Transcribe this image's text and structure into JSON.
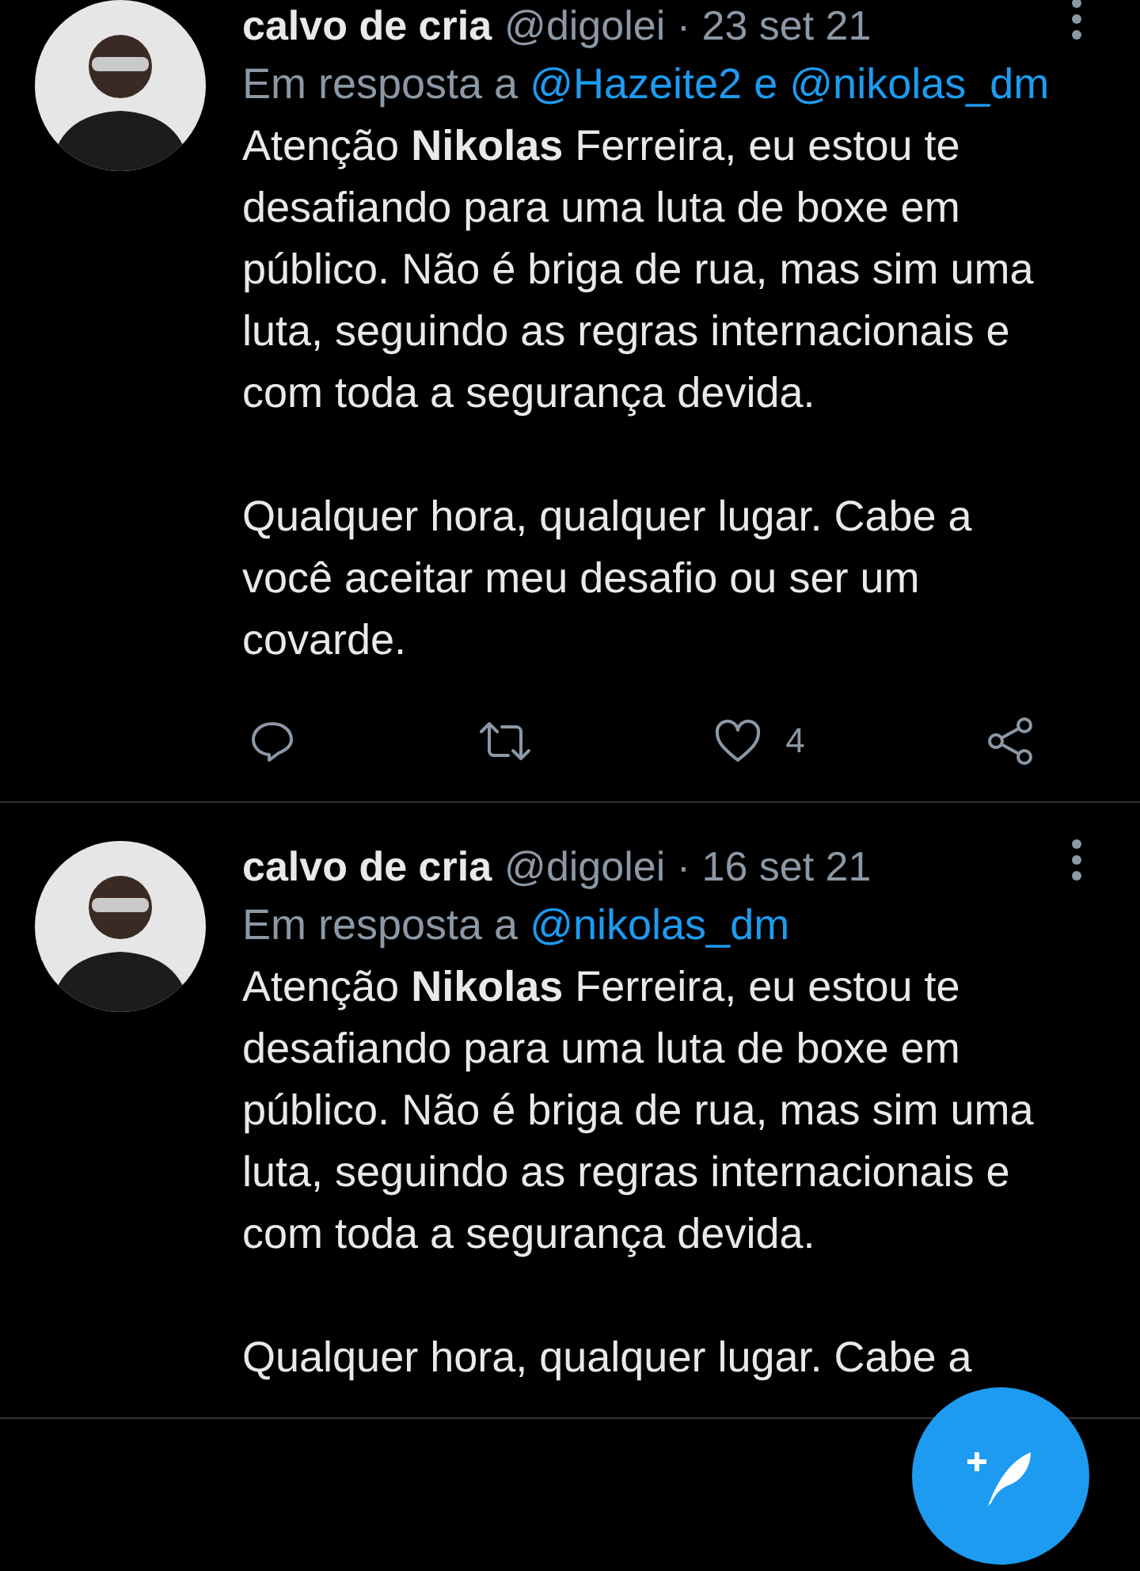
{
  "tweets": [
    {
      "name": "calvo de cria",
      "handle": "@digolei",
      "separator": "·",
      "date": "23 set 21",
      "reply_label": "Em resposta a",
      "reply_to": [
        "@Hazeite2",
        "@nikolas_dm"
      ],
      "reply_joiner": "e",
      "paragraphs": [
        "Atenção **Nikolas** Ferreira, eu estou te desafiando para uma luta de boxe em público. Não é briga de rua, mas sim uma luta, seguindo as regras internacionais e com toda a segurança devida.",
        "Qualquer hora, qualquer lugar. Cabe a você aceitar meu desafio ou ser um covarde."
      ],
      "likes": "4"
    },
    {
      "name": "calvo de cria",
      "handle": "@digolei",
      "separator": "·",
      "date": "16 set 21",
      "reply_label": "Em resposta a",
      "reply_to": [
        "@nikolas_dm"
      ],
      "paragraphs": [
        "Atenção **Nikolas** Ferreira, eu estou te desafiando para uma luta de boxe em público. Não é briga de rua, mas sim uma luta, seguindo as regras internacionais e com toda a segurança devida.",
        "Qualquer hora, qualquer lugar. Cabe a"
      ]
    }
  ]
}
